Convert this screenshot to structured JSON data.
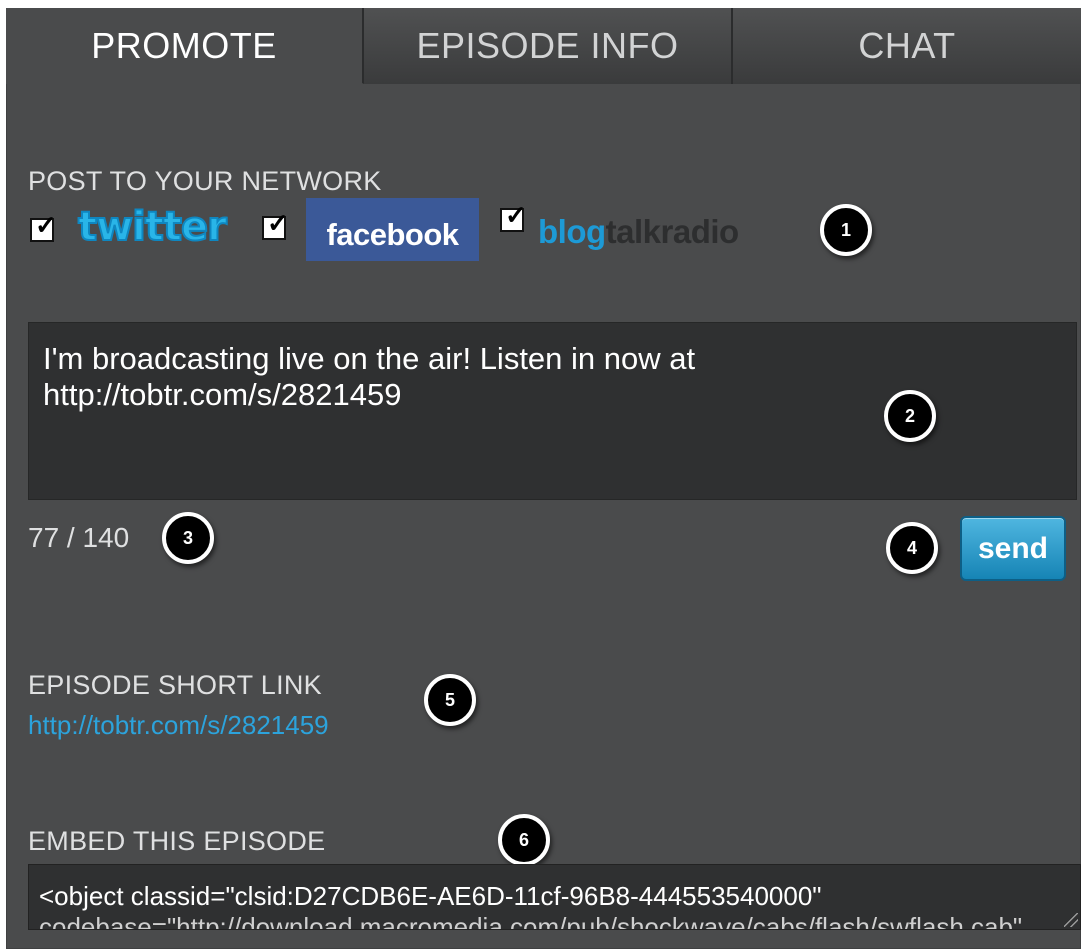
{
  "tabs": [
    {
      "label": "PROMOTE",
      "active": true
    },
    {
      "label": "EPISODE INFO",
      "active": false
    },
    {
      "label": "CHAT",
      "active": false
    }
  ],
  "network": {
    "heading": "POST TO YOUR NETWORK",
    "twitter": {
      "label": "twitter",
      "checked": true
    },
    "facebook": {
      "label": "facebook",
      "checked": true
    },
    "blogtalkradio": {
      "label_blog": "blog",
      "label_rest": "talkradio",
      "checked": true
    }
  },
  "message": {
    "value": "I'm broadcasting live on the air! Listen in now at http://tobtr.com/s/2821459",
    "char_count": "77 / 140"
  },
  "send_button": {
    "label": "send"
  },
  "short_link": {
    "heading": "EPISODE SHORT LINK",
    "url": "http://tobtr.com/s/2821459"
  },
  "embed": {
    "heading": "EMBED THIS EPISODE",
    "code_line1": "<object classid=\"clsid:D27CDB6E-AE6D-11cf-96B8-444553540000\"",
    "code_line2": "codebase=\"http://download.macromedia.com/pub/shockwave/cabs/flash/swflash.cab\""
  },
  "markers": [
    "1",
    "2",
    "3",
    "4",
    "5",
    "6"
  ],
  "colors": {
    "panel_bg": "#4a4b4c",
    "link": "#2ca3dc",
    "send_button": "#1d8fc2",
    "facebook": "#3b5998",
    "twitter": "#29b5e8"
  }
}
